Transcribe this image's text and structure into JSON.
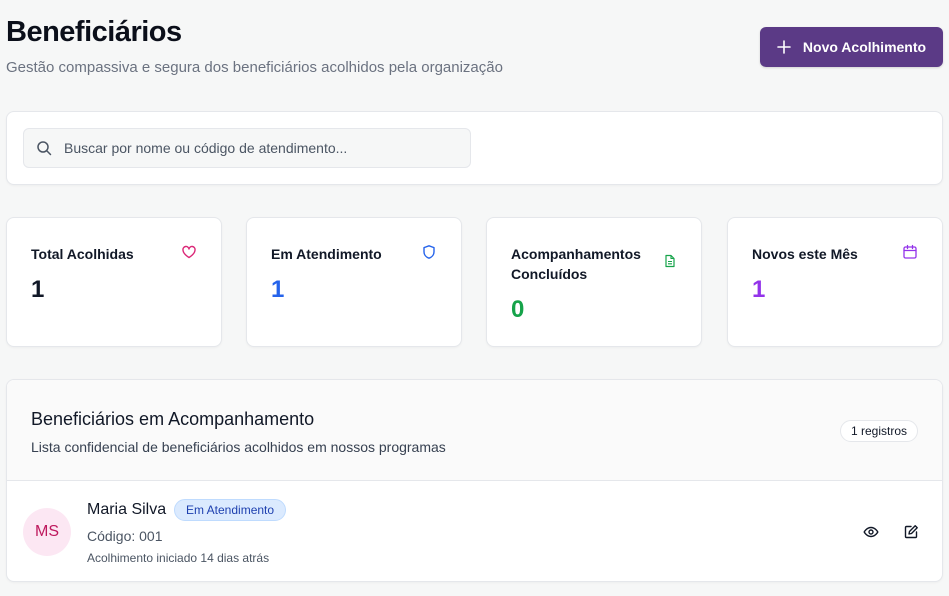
{
  "header": {
    "title": "Beneficiários",
    "subtitle": "Gestão compassiva e segura dos beneficiários acolhidos pela organização",
    "new_button_label": "Novo Acolhimento",
    "new_button_icon": "plus-icon",
    "accent_color": "#5b3a86"
  },
  "search": {
    "placeholder": "Buscar por nome ou código de atendimento...",
    "value": "",
    "icon": "search-icon"
  },
  "stats": [
    {
      "label": "Total Acolhidas",
      "value": "1",
      "icon": "heart-icon",
      "color": "#111827",
      "icon_color": "#db2777"
    },
    {
      "label": "Em Atendimento",
      "value": "1",
      "icon": "shield-icon",
      "color": "#2563eb",
      "icon_color": "#2563eb"
    },
    {
      "label": "Acompanhamentos Concluídos",
      "value": "0",
      "icon": "document-icon",
      "color": "#16a34a",
      "icon_color": "#16a34a"
    },
    {
      "label": "Novos este Mês",
      "value": "1",
      "icon": "calendar-icon",
      "color": "#9333ea",
      "icon_color": "#9333ea"
    }
  ],
  "list": {
    "title": "Beneficiários em Acompanhamento",
    "description": "Lista confidencial de beneficiários acolhidos em nossos programas",
    "count_badge": "1 registros",
    "items": [
      {
        "initials": "MS",
        "name": "Maria Silva",
        "status": "Em Atendimento",
        "code": "Código: 001",
        "since": "Acolhimento iniciado 14 dias atrás",
        "actions": [
          "eye-icon",
          "edit-icon"
        ]
      }
    ]
  }
}
